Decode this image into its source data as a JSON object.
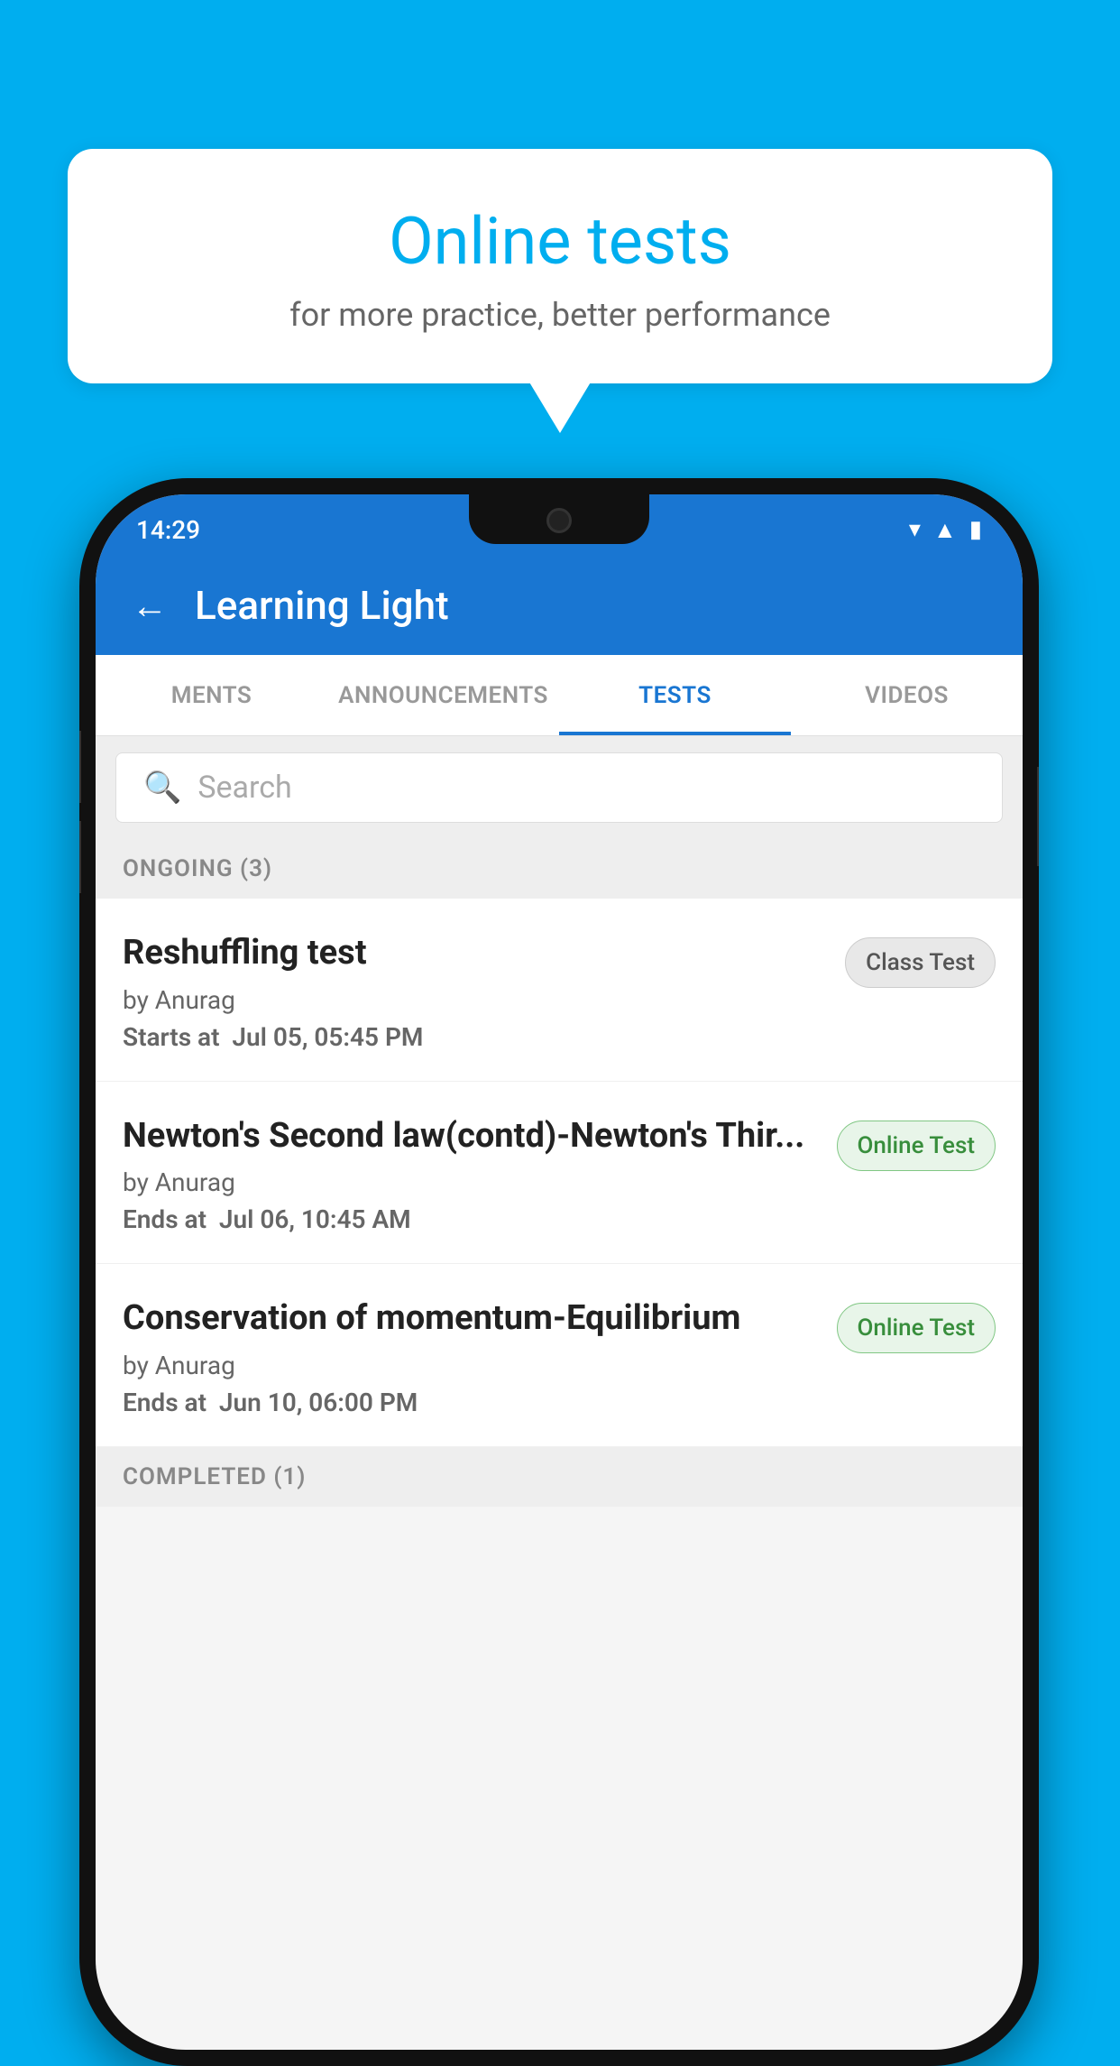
{
  "background_color": "#00AEEF",
  "speech_bubble": {
    "title": "Online tests",
    "subtitle": "for more practice, better performance"
  },
  "phone": {
    "status_bar": {
      "time": "14:29",
      "icons": [
        "wifi",
        "signal",
        "battery"
      ]
    },
    "app_bar": {
      "back_label": "←",
      "title": "Learning Light"
    },
    "tabs": [
      {
        "label": "MENTS",
        "active": false
      },
      {
        "label": "ANNOUNCEMENTS",
        "active": false
      },
      {
        "label": "TESTS",
        "active": true
      },
      {
        "label": "VIDEOS",
        "active": false
      }
    ],
    "search": {
      "placeholder": "Search"
    },
    "sections": [
      {
        "header": "ONGOING (3)",
        "items": [
          {
            "name": "Reshuffling test",
            "author": "by Anurag",
            "time_label": "Starts at",
            "time_value": "Jul 05, 05:45 PM",
            "badge": "Class Test",
            "badge_type": "class"
          },
          {
            "name": "Newton's Second law(contd)-Newton's Thir...",
            "author": "by Anurag",
            "time_label": "Ends at",
            "time_value": "Jul 06, 10:45 AM",
            "badge": "Online Test",
            "badge_type": "online"
          },
          {
            "name": "Conservation of momentum-Equilibrium",
            "author": "by Anurag",
            "time_label": "Ends at",
            "time_value": "Jun 10, 06:00 PM",
            "badge": "Online Test",
            "badge_type": "online"
          }
        ]
      },
      {
        "header": "COMPLETED (1)",
        "items": []
      }
    ]
  }
}
